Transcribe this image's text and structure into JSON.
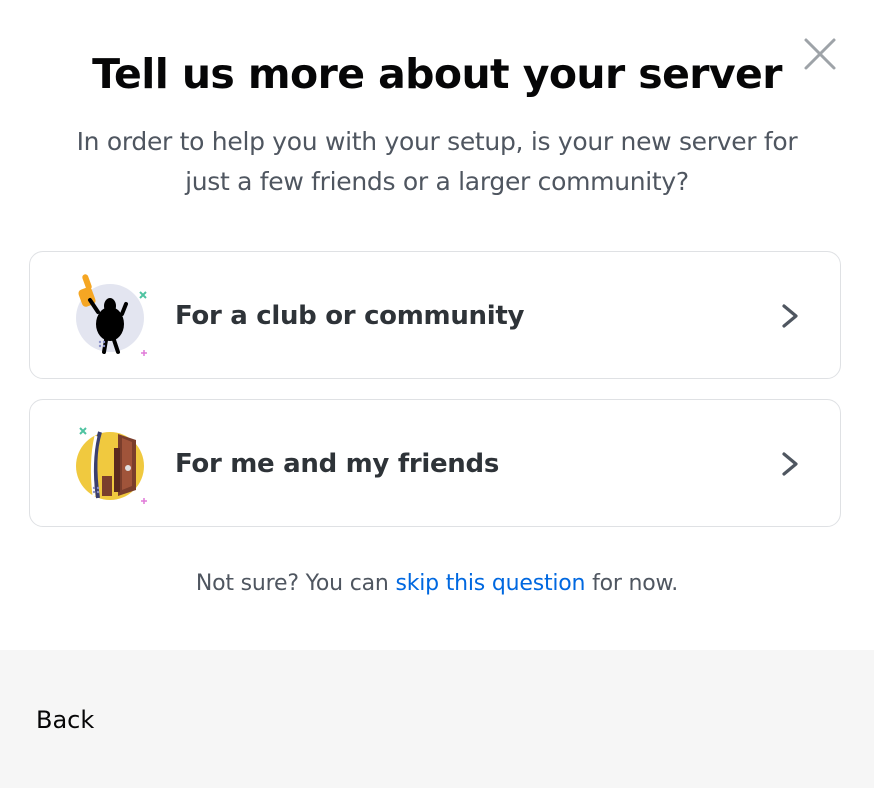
{
  "modal": {
    "title": "Tell us more about your server",
    "subtitle_line1": "In order to help you with your setup, is your new server for",
    "subtitle_line2": "just a few friends or a larger community?",
    "close_icon": "close-icon",
    "options": [
      {
        "label": "For a club or community",
        "icon": "club-illustration-icon",
        "chevron": "chevron-right-icon"
      },
      {
        "label": "For me and my friends",
        "icon": "friends-door-illustration-icon",
        "chevron": "chevron-right-icon"
      }
    ],
    "hint": {
      "prefix": "Not sure? You can ",
      "link": "skip this question",
      "suffix": " for now."
    }
  },
  "footer": {
    "back_label": "Back"
  },
  "colors": {
    "title": "#060607",
    "body_text": "#4f5660",
    "link": "#0068e0",
    "border": "#dfe1e4",
    "footer_bg": "#f6f6f6",
    "accent_yellow": "#f0c93f",
    "accent_orange": "#f5a623"
  }
}
